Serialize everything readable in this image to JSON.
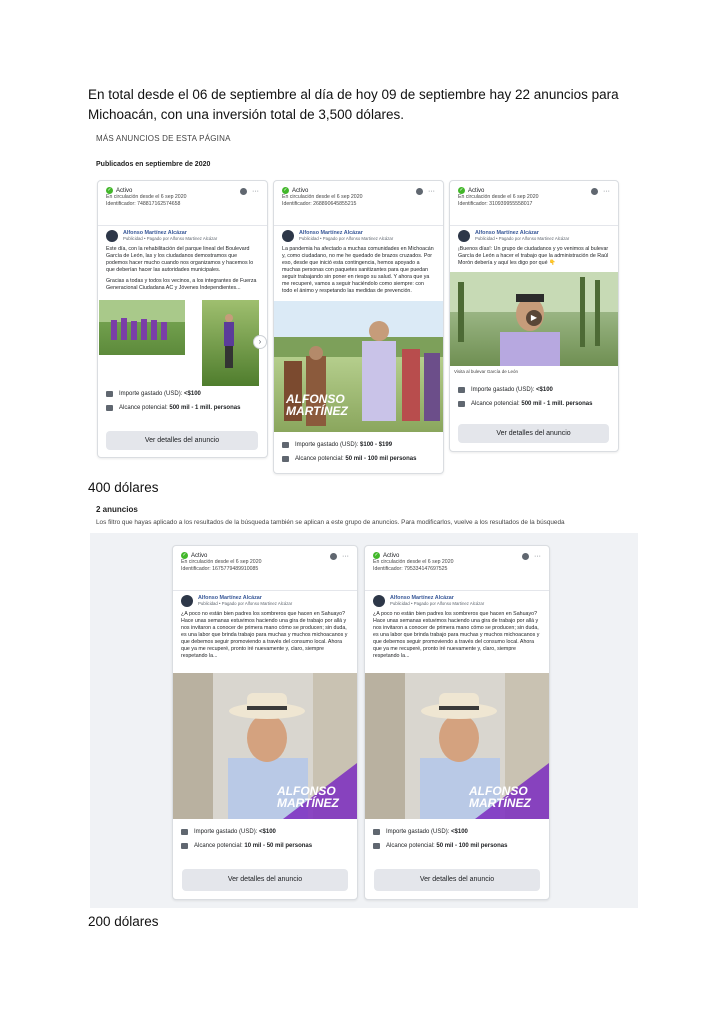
{
  "intro": {
    "line1": "En total desde el 06 de septiembre al día de hoy 09 de septiembre hay 22 anuncios para",
    "line2": "Michoacán, con una inversión total de 3,500 dólares."
  },
  "section": {
    "title": "MÁS ANUNCIOS DE ESTA PÁGINA",
    "subtitle": "Publicados en septiembre de 2020"
  },
  "amount_1": "400 dólares",
  "group": {
    "count": "2 anuncios",
    "note": "Los filtro que hayas aplicado a los resultados de la búsqueda también se aplican a este grupo de anuncios. Para modificarlos, vuelve a los resultados de la búsqueda"
  },
  "amount_2": "200 dólares",
  "common": {
    "status": "Activo",
    "running": "En circulación desde el 6 sep 2020",
    "advertiser": "Alfonso Martínez Alcázar",
    "paid_by": "Publicidad • Pagado por Alfonso Martinez Alcázar",
    "spend_label": "Importe gastado (USD):",
    "reach_label": "Alcance potencial:",
    "details_button": "Ver detalles del anuncio",
    "brand_line1": "ALFONSO",
    "brand_line2": "MARTÍNEZ"
  },
  "ads": [
    {
      "id": "Identificador: 748817162574658",
      "text": "Este día, con la rehabilitación del parque lineal del Boulevard García de León, las y los ciudadanos demostramos que podemos hacer mucho cuando nos organizamos y hacemos lo que deberían hacer las autoridades municipales.",
      "text2": "Gracias a todas y todos los vecinos, a los integrantes de Fuerza Generacional Ciudadana AC y Jóvenes Independientes...",
      "spend": "<$100",
      "reach": "500 mil - 1 mill. personas"
    },
    {
      "id": "Identificador: 268890645855215",
      "text": "La pandemia ha afectado a muchas comunidades en Michoacán y, como ciudadano, no me he quedado de brazos cruzados. Por eso, desde que inició esta contingencia, hemos apoyado a muchas personas con paquetes sanitizantes para que puedan seguir trabajando sin poner en riesgo su salud. Y ahora que ya me recuperé, vamos a seguir haciéndolo como siempre: con todo el ánimo y respetando las medidas de prevención.",
      "spend": "$100 - $199",
      "reach": "50 mil - 100 mil personas"
    },
    {
      "id": "Identificador: 310939955558017",
      "text": "¡Buenos días!: Un grupo de ciudadanos y yo venimos al bulevar García de León a hacer el trabajo que la administración de Raúl Morón debería y aquí les digo por qué 👇",
      "caption": "Visita al bulevar García de León",
      "spend": "<$100",
      "reach": "500 mil - 1 mill. personas"
    },
    {
      "id": "Identificador: 1675779489910085",
      "text": "¿A poco no están bien padres los sombreros que hacen en Sahuayo? Hace unas semanas estuvimos haciendo una gira de trabajo por allá y nos invitaron a conocer de primera mano cómo se producen; sin duda, es una labor que brinda trabajo para muchas y muchos michoacanos y que debemos seguir promoviendo a través del consumo local. Ahora que ya me recuperé, pronto iré nuevamente y, claro, siempre respetando la...",
      "spend": "<$100",
      "reach": "10 mil - 50 mil personas"
    },
    {
      "id": "Identificador: 795334147697525",
      "text": "¿A poco no están bien padres los sombreros que hacen en Sahuayo? Hace unas semanas estuvimos haciendo una gira de trabajo por allá y nos invitaron a conocer de primera mano cómo se producen; sin duda, es una labor que brinda trabajo para muchas y muchos michoacanos y que debemos seguir promoviendo a través del consumo local. Ahora que ya me recuperé, pronto iré nuevamente y, claro, siempre respetando la...",
      "spend": "<$100",
      "reach": "50 mil - 100 mil personas"
    }
  ]
}
